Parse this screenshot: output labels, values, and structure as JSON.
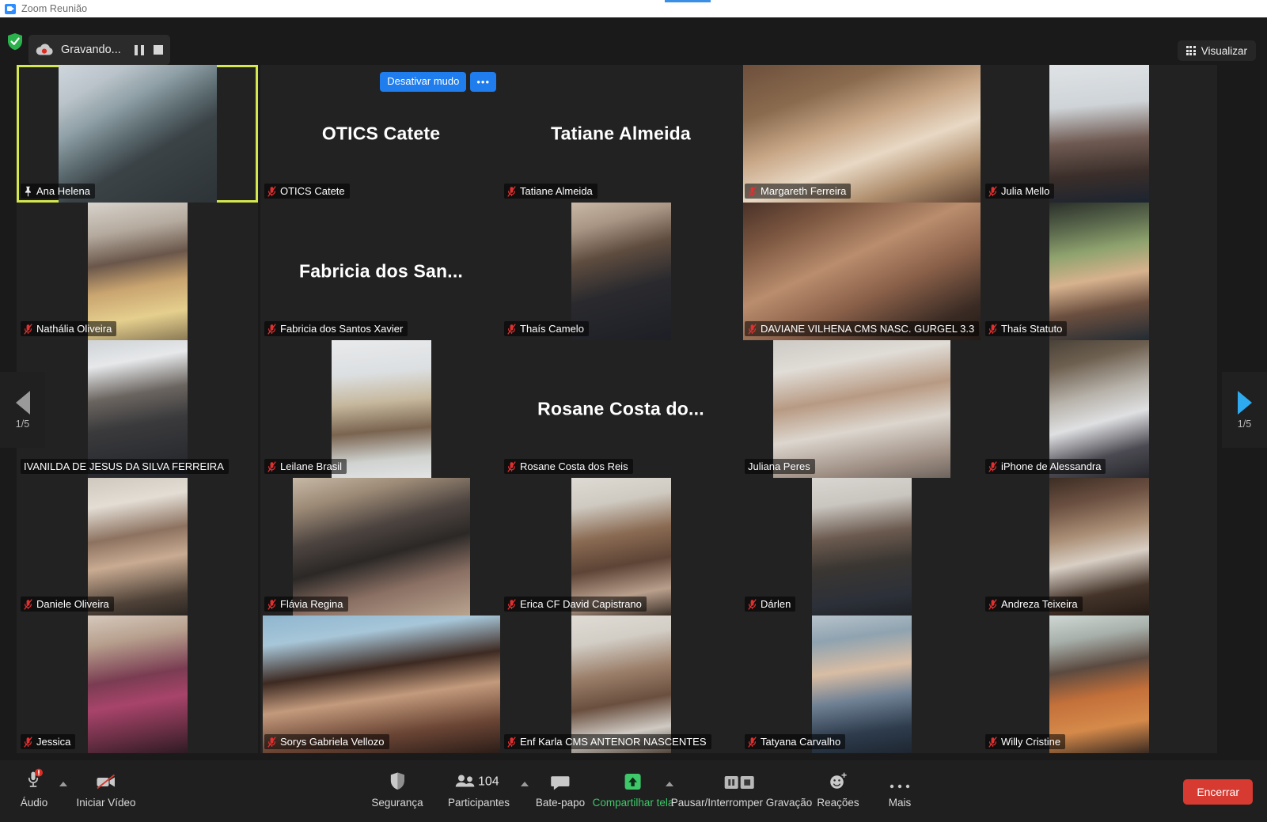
{
  "window": {
    "title": "Zoom Reunião",
    "icon": "zoom-logo-icon"
  },
  "topbar": {
    "security_icon": "shield-check-icon",
    "recording_label": "Gravando...",
    "recording_cloud_icon": "cloud-record-icon",
    "pause_icon": "pause-icon",
    "stop_icon": "stop-icon",
    "view_button": {
      "label": "Visualizar",
      "icon": "grid-view-icon"
    }
  },
  "gallery": {
    "prev": {
      "icon": "chevron-left-icon",
      "page": "1/5"
    },
    "next": {
      "icon": "chevron-right-icon",
      "page": "1/5"
    },
    "hover_tile_controls": {
      "unmute_label": "Desativar mudo",
      "more_label": "•••"
    },
    "participants": [
      {
        "name": "Ana Helena",
        "muted": false,
        "pinned": true,
        "active": true,
        "video": true,
        "video_css": "linear-gradient(150deg,#cfd7dd 0%,#b9c3c9 18%,#8fa0a6 33%,#5e6e73 48%,#3b4347 62%,#2d3336 100%)",
        "vw": 200,
        "big_name": ""
      },
      {
        "name": "OTICS Catete",
        "muted": true,
        "pinned": false,
        "active": false,
        "video": false,
        "video_css": "",
        "vw": 0,
        "big_name": "OTICS Catete",
        "show_controls": true
      },
      {
        "name": "Tatiane Almeida",
        "muted": true,
        "pinned": false,
        "active": false,
        "video": false,
        "video_css": "",
        "vw": 0,
        "big_name": "Tatiane Almeida"
      },
      {
        "name": "Margareth Ferreira",
        "muted": true,
        "pinned": false,
        "active": false,
        "video": true,
        "video_css": "linear-gradient(160deg,#6d4f3c 0%,#8a6b4e 25%,#c9a888 45%,#e8d8c4 62%,#b08f6e 80%,#5d4232 100%)",
        "vw": 300,
        "big_name": ""
      },
      {
        "name": "Julia Mello",
        "muted": true,
        "pinned": false,
        "active": false,
        "video": true,
        "video_css": "linear-gradient(175deg,#dfe3e6 0%,#cfd4d8 30%,#6f5a52 55%,#3a2e2a 78%,#1c2430 100%)",
        "vw": 126,
        "big_name": ""
      },
      {
        "name": "Nathália Oliveira",
        "muted": true,
        "pinned": false,
        "active": false,
        "video": true,
        "video_css": "linear-gradient(170deg,#d8d3cc 0%,#b5aa9e 22%,#6a564a 42%,#c9a46f 60%,#e5cf8e 80%,#8b7a55 100%)",
        "vw": 126,
        "big_name": ""
      },
      {
        "name": "Fabricia dos Santos Xavier",
        "muted": true,
        "pinned": false,
        "active": false,
        "video": false,
        "video_css": "",
        "vw": 0,
        "big_name": "Fabricia dos San..."
      },
      {
        "name": "Thaís Camelo",
        "muted": true,
        "pinned": false,
        "active": false,
        "video": true,
        "video_css": "linear-gradient(165deg,#c9b9a6 0%,#a99584 18%,#5e4c3f 38%,#2a2a2e 62%,#1d1f26 100%)",
        "vw": 126,
        "big_name": ""
      },
      {
        "name": "DAVIANE VILHENA CMS NASC. GURGEL 3.3",
        "muted": true,
        "pinned": false,
        "active": false,
        "video": true,
        "video_css": "linear-gradient(155deg,#4a3228 0%,#7d5741 20%,#b98d6d 42%,#8a6049 62%,#3a2b24 85%,#241b16 100%)",
        "vw": 300,
        "big_name": ""
      },
      {
        "name": "Thaís Statuto",
        "muted": true,
        "pinned": false,
        "active": false,
        "video": true,
        "video_css": "linear-gradient(170deg,#2a2f2a 0%,#5d6b4e 20%,#8fa36e 36%,#d7b28e 55%,#6b4f3f 75%,#222b33 100%)",
        "vw": 126,
        "big_name": ""
      },
      {
        "name": "IVANILDA DE JESUS DA SILVA FERREIRA",
        "muted": false,
        "pinned": false,
        "active": false,
        "video": true,
        "video_css": "linear-gradient(170deg,#cfd3d6 0%,#e6e8ea 18%,#6b6560 40%,#3a3a3c 60%,#22242a 100%)",
        "vw": 126,
        "big_name": ""
      },
      {
        "name": "Leilane Brasil",
        "muted": true,
        "pinned": false,
        "active": false,
        "video": true,
        "video_css": "linear-gradient(175deg,#e8eaec 0%,#dcdfe1 25%,#c6b89d 45%,#7a6450 65%,#cfd2cf 85%,#e2e4e4 100%)",
        "vw": 126,
        "big_name": ""
      },
      {
        "name": "Rosane Costa dos Reis",
        "muted": true,
        "pinned": false,
        "active": false,
        "video": false,
        "video_css": "",
        "vw": 0,
        "big_name": "Rosane Costa do..."
      },
      {
        "name": "Juliana Peres",
        "muted": false,
        "pinned": false,
        "active": false,
        "video": true,
        "video_css": "linear-gradient(170deg,#cdc9c4 0%,#e0dcd6 20%,#b89a83 42%,#dcd6ce 62%,#9f8f84 85%,#6e655e 100%)",
        "vw": 224,
        "big_name": ""
      },
      {
        "name": "iPhone de Alessandra",
        "muted": true,
        "pinned": false,
        "active": false,
        "video": true,
        "video_css": "linear-gradient(165deg,#4a4238 0%,#6e6050 18%,#b7b2aa 40%,#dfe0e2 58%,#4b4a52 80%,#26272c 100%)",
        "vw": 126,
        "big_name": ""
      },
      {
        "name": "Daniele Oliveira",
        "muted": true,
        "pinned": false,
        "active": false,
        "video": true,
        "video_css": "linear-gradient(170deg,#cfc8bf 0%,#e3ddd4 20%,#8d7260 42%,#c9ab92 60%,#4f4238 85%,#2b2622 100%)",
        "vw": 126,
        "big_name": ""
      },
      {
        "name": "Flávia Regina",
        "muted": true,
        "pinned": false,
        "active": false,
        "video": true,
        "video_css": "linear-gradient(165deg,#c7b9a6 0%,#9c8a76 18%,#4d4440 38%,#2b2826 55%,#8a6f63 75%,#b9a48f 100%)",
        "vw": 224,
        "big_name": ""
      },
      {
        "name": "Erica CF David Capistrano",
        "muted": true,
        "pinned": false,
        "active": false,
        "video": true,
        "video_css": "linear-gradient(170deg,#dedbd4 0%,#cfcac1 20%,#8a6a52 42%,#5d4436 62%,#b99f8c 82%,#3a2f27 100%)",
        "vw": 126,
        "big_name": ""
      },
      {
        "name": "Dárlen",
        "muted": true,
        "pinned": false,
        "active": false,
        "video": true,
        "video_css": "linear-gradient(172deg,#d9d6d1 0%,#c9c5bf 20%,#6b5a4f 42%,#3a3632 62%,#2c3038 85%,#1f2227 100%)",
        "vw": 126,
        "big_name": ""
      },
      {
        "name": "Andreza Teixeira",
        "muted": true,
        "pinned": false,
        "active": false,
        "video": true,
        "video_css": "linear-gradient(168deg,#3c2d24 0%,#6d5142 20%,#a98d74 40%,#d9cfc4 58%,#44342a 80%,#241b15 100%)",
        "vw": 126,
        "big_name": ""
      },
      {
        "name": "Jessica",
        "muted": true,
        "pinned": false,
        "active": false,
        "video": true,
        "video_css": "linear-gradient(170deg,#d6c9bd 0%,#b79f8d 20%,#7a3c52 45%,#a8446a 62%,#6a2f45 82%,#2e1b24 100%)",
        "vw": 126,
        "big_name": ""
      },
      {
        "name": "Sorys Gabriela Vellozo",
        "muted": true,
        "pinned": false,
        "active": false,
        "video": true,
        "video_css": "linear-gradient(172deg,#8fb6cf 0%,#a7c6d8 18%,#3d2a22 40%,#c39a7c 58%,#6b4535 80%,#2b1d18 100%)",
        "vw": 300,
        "big_name": ""
      },
      {
        "name": "Enf Karla CMS ANTENOR NASCENTES",
        "muted": true,
        "pinned": false,
        "active": false,
        "video": true,
        "video_css": "linear-gradient(170deg,#e0dcd5 0%,#d2cdc5 20%,#9b7f6a 42%,#6a4f3f 62%,#cfcac3 82%,#50443a 100%)",
        "vw": 126,
        "big_name": ""
      },
      {
        "name": "Tatyana Carvalho",
        "muted": true,
        "pinned": false,
        "active": false,
        "video": true,
        "video_css": "linear-gradient(172deg,#b7c3cc 0%,#8fa3b0 18%,#d8bda4 40%,#6f8194 60%,#2e3c4d 82%,#1e2631 100%)",
        "vw": 126,
        "big_name": ""
      },
      {
        "name": "Willy Cristine",
        "muted": true,
        "pinned": false,
        "active": false,
        "video": true,
        "video_css": "linear-gradient(170deg,#cfd8d4 0%,#a8b0ab 18%,#5b4a40 38%,#c4703a 58%,#d58a4a 78%,#3a2b22 100%)",
        "vw": 126,
        "big_name": ""
      }
    ]
  },
  "toolbar": {
    "items": [
      {
        "id": "audio",
        "label": "Áudio",
        "icon": "microphone-muted-icon",
        "caret": true,
        "badge": "!"
      },
      {
        "id": "video",
        "label": "Iniciar Vídeo",
        "icon": "camera-off-icon",
        "caret": false
      },
      {
        "id": "security",
        "label": "Segurança",
        "icon": "shield-icon",
        "caret": false
      },
      {
        "id": "participants",
        "label": "Participantes",
        "icon": "people-icon",
        "caret": true,
        "count": "104"
      },
      {
        "id": "chat",
        "label": "Bate-papo",
        "icon": "chat-bubble-icon",
        "caret": false
      },
      {
        "id": "share",
        "label": "Compartilhar tela",
        "icon": "share-screen-icon",
        "caret": true
      },
      {
        "id": "record",
        "label": "Pausar/Interromper Gravação",
        "icon": "pause-stop-icon",
        "caret": false
      },
      {
        "id": "reactions",
        "label": "Reações",
        "icon": "smiley-plus-icon",
        "caret": false
      },
      {
        "id": "more",
        "label": "Mais",
        "icon": "ellipsis-icon",
        "caret": false
      }
    ],
    "end_button": {
      "label": "Encerrar"
    },
    "share_color": "#3ec86a",
    "end_color": "#d63a31"
  }
}
